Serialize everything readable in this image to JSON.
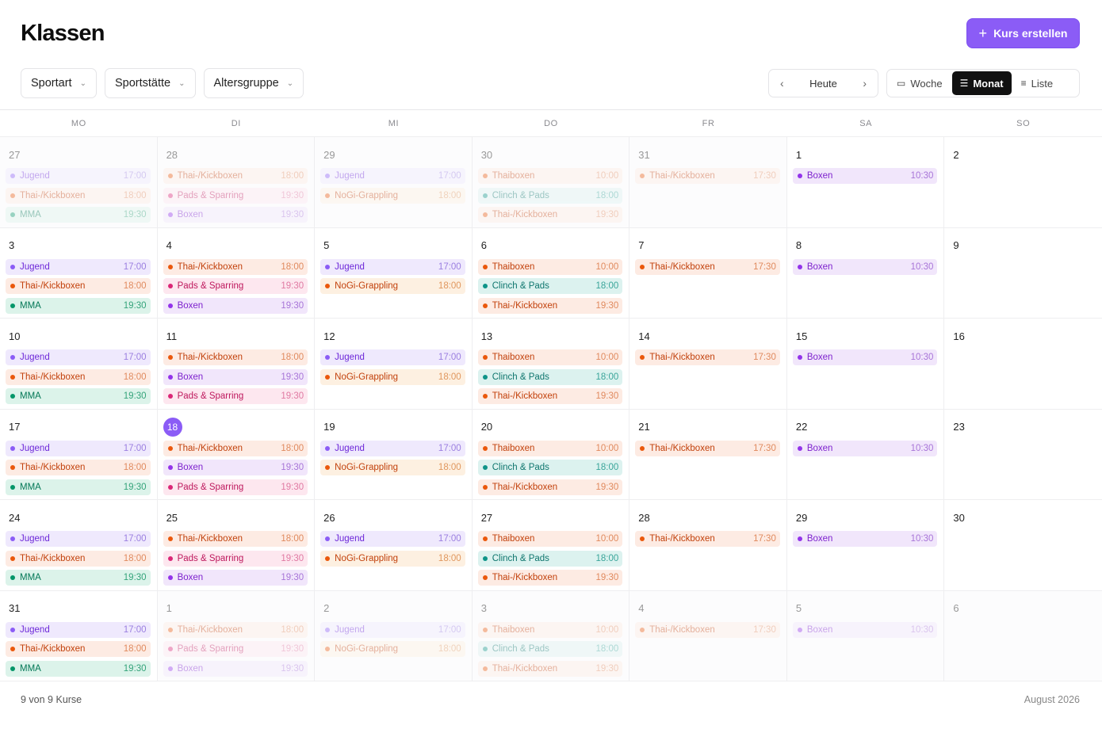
{
  "header": {
    "title": "Klassen",
    "create_label": "Kurs erstellen",
    "create_icon": "plus-icon"
  },
  "filters": [
    {
      "label": "Sportart",
      "icon": "chevron-down-icon"
    },
    {
      "label": "Sportstätte",
      "icon": "chevron-down-icon"
    },
    {
      "label": "Altersgruppe",
      "icon": "chevron-down-icon"
    }
  ],
  "nav": {
    "prev_icon": "chevron-left-icon",
    "today_label": "Heute",
    "next_icon": "chevron-right-icon"
  },
  "views": [
    {
      "label": "Woche",
      "icon": "calendar-icon",
      "active": false
    },
    {
      "label": "Monat",
      "icon": "grid-icon",
      "active": true
    },
    {
      "label": "Liste",
      "icon": "list-icon",
      "active": false
    }
  ],
  "weekdays": [
    "MO",
    "DI",
    "MI",
    "DO",
    "FR",
    "SA",
    "SO"
  ],
  "categories": {
    "Jugend": {
      "bg": "#efe9fd",
      "dot": "#8b5cf6",
      "text": "#6d28d9",
      "time": "#9b7fe0"
    },
    "Thai-/Kickboxen": {
      "bg": "#fdebe3",
      "dot": "#ea580c",
      "text": "#c2410c",
      "time": "#e08a5e"
    },
    "MMA": {
      "bg": "#dcf3ea",
      "dot": "#059669",
      "text": "#047857",
      "time": "#34a37a"
    },
    "Pads & Sparring": {
      "bg": "#fde7ef",
      "dot": "#db2777",
      "text": "#be185d",
      "time": "#e07aa3"
    },
    "Boxen": {
      "bg": "#f1e6fb",
      "dot": "#9333ea",
      "text": "#7e22ce",
      "time": "#a875d8"
    },
    "NoGi-Grappling": {
      "bg": "#fdf0e1",
      "dot": "#ea580c",
      "text": "#c2410c",
      "time": "#e0975e"
    },
    "Thaiboxen": {
      "bg": "#fdebe3",
      "dot": "#ea580c",
      "text": "#c2410c",
      "time": "#e08a5e"
    },
    "Clinch & Pads": {
      "bg": "#dcf2ef",
      "dot": "#0d9488",
      "text": "#0f766e",
      "time": "#3aa59a"
    }
  },
  "cells": [
    {
      "day": "27",
      "outside": true,
      "events": [
        [
          "Jugend",
          "17:00"
        ],
        [
          "Thai-/Kickboxen",
          "18:00"
        ],
        [
          "MMA",
          "19:30"
        ]
      ]
    },
    {
      "day": "28",
      "outside": true,
      "events": [
        [
          "Thai-/Kickboxen",
          "18:00"
        ],
        [
          "Pads & Sparring",
          "19:30"
        ],
        [
          "Boxen",
          "19:30"
        ]
      ]
    },
    {
      "day": "29",
      "outside": true,
      "events": [
        [
          "Jugend",
          "17:00"
        ],
        [
          "NoGi-Grappling",
          "18:00"
        ]
      ]
    },
    {
      "day": "30",
      "outside": true,
      "events": [
        [
          "Thaiboxen",
          "10:00"
        ],
        [
          "Clinch & Pads",
          "18:00"
        ],
        [
          "Thai-/Kickboxen",
          "19:30"
        ]
      ]
    },
    {
      "day": "31",
      "outside": true,
      "events": [
        [
          "Thai-/Kickboxen",
          "17:30"
        ]
      ]
    },
    {
      "day": "1",
      "outside": false,
      "events": [
        [
          "Boxen",
          "10:30"
        ]
      ]
    },
    {
      "day": "2",
      "outside": false,
      "events": []
    },
    {
      "day": "3",
      "outside": false,
      "events": [
        [
          "Jugend",
          "17:00"
        ],
        [
          "Thai-/Kickboxen",
          "18:00"
        ],
        [
          "MMA",
          "19:30"
        ]
      ]
    },
    {
      "day": "4",
      "outside": false,
      "events": [
        [
          "Thai-/Kickboxen",
          "18:00"
        ],
        [
          "Pads & Sparring",
          "19:30"
        ],
        [
          "Boxen",
          "19:30"
        ]
      ]
    },
    {
      "day": "5",
      "outside": false,
      "events": [
        [
          "Jugend",
          "17:00"
        ],
        [
          "NoGi-Grappling",
          "18:00"
        ]
      ]
    },
    {
      "day": "6",
      "outside": false,
      "events": [
        [
          "Thaiboxen",
          "10:00"
        ],
        [
          "Clinch & Pads",
          "18:00"
        ],
        [
          "Thai-/Kickboxen",
          "19:30"
        ]
      ]
    },
    {
      "day": "7",
      "outside": false,
      "events": [
        [
          "Thai-/Kickboxen",
          "17:30"
        ]
      ]
    },
    {
      "day": "8",
      "outside": false,
      "events": [
        [
          "Boxen",
          "10:30"
        ]
      ]
    },
    {
      "day": "9",
      "outside": false,
      "events": []
    },
    {
      "day": "10",
      "outside": false,
      "events": [
        [
          "Jugend",
          "17:00"
        ],
        [
          "Thai-/Kickboxen",
          "18:00"
        ],
        [
          "MMA",
          "19:30"
        ]
      ]
    },
    {
      "day": "11",
      "outside": false,
      "events": [
        [
          "Thai-/Kickboxen",
          "18:00"
        ],
        [
          "Boxen",
          "19:30"
        ],
        [
          "Pads & Sparring",
          "19:30"
        ]
      ]
    },
    {
      "day": "12",
      "outside": false,
      "events": [
        [
          "Jugend",
          "17:00"
        ],
        [
          "NoGi-Grappling",
          "18:00"
        ]
      ]
    },
    {
      "day": "13",
      "outside": false,
      "events": [
        [
          "Thaiboxen",
          "10:00"
        ],
        [
          "Clinch & Pads",
          "18:00"
        ],
        [
          "Thai-/Kickboxen",
          "19:30"
        ]
      ]
    },
    {
      "day": "14",
      "outside": false,
      "events": [
        [
          "Thai-/Kickboxen",
          "17:30"
        ]
      ]
    },
    {
      "day": "15",
      "outside": false,
      "events": [
        [
          "Boxen",
          "10:30"
        ]
      ]
    },
    {
      "day": "16",
      "outside": false,
      "events": []
    },
    {
      "day": "17",
      "outside": false,
      "events": [
        [
          "Jugend",
          "17:00"
        ],
        [
          "Thai-/Kickboxen",
          "18:00"
        ],
        [
          "MMA",
          "19:30"
        ]
      ]
    },
    {
      "day": "18",
      "outside": false,
      "today": true,
      "events": [
        [
          "Thai-/Kickboxen",
          "18:00"
        ],
        [
          "Boxen",
          "19:30"
        ],
        [
          "Pads & Sparring",
          "19:30"
        ]
      ]
    },
    {
      "day": "19",
      "outside": false,
      "events": [
        [
          "Jugend",
          "17:00"
        ],
        [
          "NoGi-Grappling",
          "18:00"
        ]
      ]
    },
    {
      "day": "20",
      "outside": false,
      "events": [
        [
          "Thaiboxen",
          "10:00"
        ],
        [
          "Clinch & Pads",
          "18:00"
        ],
        [
          "Thai-/Kickboxen",
          "19:30"
        ]
      ]
    },
    {
      "day": "21",
      "outside": false,
      "events": [
        [
          "Thai-/Kickboxen",
          "17:30"
        ]
      ]
    },
    {
      "day": "22",
      "outside": false,
      "events": [
        [
          "Boxen",
          "10:30"
        ]
      ]
    },
    {
      "day": "23",
      "outside": false,
      "events": []
    },
    {
      "day": "24",
      "outside": false,
      "events": [
        [
          "Jugend",
          "17:00"
        ],
        [
          "Thai-/Kickboxen",
          "18:00"
        ],
        [
          "MMA",
          "19:30"
        ]
      ]
    },
    {
      "day": "25",
      "outside": false,
      "events": [
        [
          "Thai-/Kickboxen",
          "18:00"
        ],
        [
          "Pads & Sparring",
          "19:30"
        ],
        [
          "Boxen",
          "19:30"
        ]
      ]
    },
    {
      "day": "26",
      "outside": false,
      "events": [
        [
          "Jugend",
          "17:00"
        ],
        [
          "NoGi-Grappling",
          "18:00"
        ]
      ]
    },
    {
      "day": "27",
      "outside": false,
      "events": [
        [
          "Thaiboxen",
          "10:00"
        ],
        [
          "Clinch & Pads",
          "18:00"
        ],
        [
          "Thai-/Kickboxen",
          "19:30"
        ]
      ]
    },
    {
      "day": "28",
      "outside": false,
      "events": [
        [
          "Thai-/Kickboxen",
          "17:30"
        ]
      ]
    },
    {
      "day": "29",
      "outside": false,
      "events": [
        [
          "Boxen",
          "10:30"
        ]
      ]
    },
    {
      "day": "30",
      "outside": false,
      "events": []
    },
    {
      "day": "31",
      "outside": false,
      "events": [
        [
          "Jugend",
          "17:00"
        ],
        [
          "Thai-/Kickboxen",
          "18:00"
        ],
        [
          "MMA",
          "19:30"
        ]
      ]
    },
    {
      "day": "1",
      "outside": true,
      "events": [
        [
          "Thai-/Kickboxen",
          "18:00"
        ],
        [
          "Pads & Sparring",
          "19:30"
        ],
        [
          "Boxen",
          "19:30"
        ]
      ]
    },
    {
      "day": "2",
      "outside": true,
      "events": [
        [
          "Jugend",
          "17:00"
        ],
        [
          "NoGi-Grappling",
          "18:00"
        ]
      ]
    },
    {
      "day": "3",
      "outside": true,
      "events": [
        [
          "Thaiboxen",
          "10:00"
        ],
        [
          "Clinch & Pads",
          "18:00"
        ],
        [
          "Thai-/Kickboxen",
          "19:30"
        ]
      ]
    },
    {
      "day": "4",
      "outside": true,
      "events": [
        [
          "Thai-/Kickboxen",
          "17:30"
        ]
      ]
    },
    {
      "day": "5",
      "outside": true,
      "events": [
        [
          "Boxen",
          "10:30"
        ]
      ]
    },
    {
      "day": "6",
      "outside": true,
      "events": []
    }
  ],
  "footer": {
    "count": "9 von 9 Kurse",
    "month": "August 2026"
  }
}
